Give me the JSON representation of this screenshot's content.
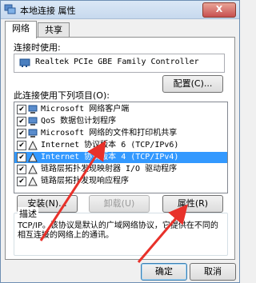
{
  "window": {
    "title": "本地连接 属性",
    "close_label": "X"
  },
  "tabs": [
    {
      "label": "网络"
    },
    {
      "label": "共享"
    }
  ],
  "connect_using": {
    "label": "连接时使用:",
    "adapter": "Realtek PCIe GBE Family Controller",
    "configure_label": "配置(C)..."
  },
  "items_label": "此连接使用下列项目(O):",
  "items": [
    {
      "label": "Microsoft 网络客户端",
      "checked": true,
      "icon": "network-client-icon"
    },
    {
      "label": "QoS 数据包计划程序",
      "checked": true,
      "icon": "qos-icon"
    },
    {
      "label": "Microsoft 网络的文件和打印机共享",
      "checked": true,
      "icon": "file-share-icon"
    },
    {
      "label": "Internet 协议版本 6 (TCP/IPv6)",
      "checked": true,
      "icon": "protocol-icon"
    },
    {
      "label": "Internet 协议版本 4 (TCP/IPv4)",
      "checked": true,
      "icon": "protocol-icon",
      "selected": true
    },
    {
      "label": "链路层拓扑发现映射器 I/O 驱动程序",
      "checked": true,
      "icon": "protocol-icon"
    },
    {
      "label": "链路层拓扑发现响应程序",
      "checked": true,
      "icon": "protocol-icon"
    }
  ],
  "buttons": {
    "install": "安装(N)...",
    "uninstall": "卸载(U)",
    "properties": "属性(R)"
  },
  "description": {
    "title": "描述",
    "text": "TCP/IP。该协议是默认的广域网络协议，它提供在不同的相互连接的网络上的通讯。"
  },
  "footer": {
    "ok": "确定",
    "cancel": "取消"
  },
  "colors": {
    "selection": "#3399ff",
    "annotation_arrow": "#e8312a"
  }
}
